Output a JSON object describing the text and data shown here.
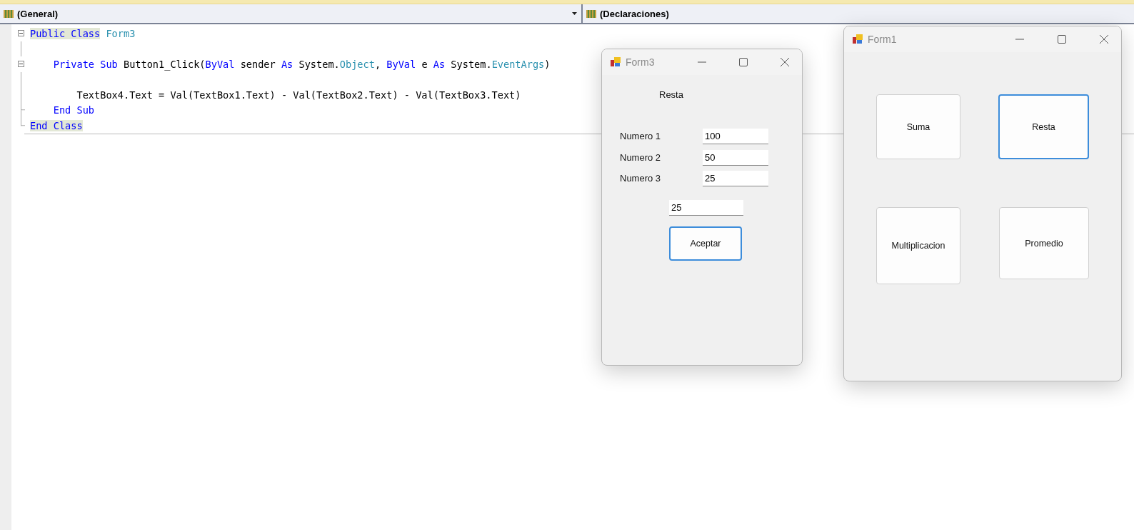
{
  "editor": {
    "object_dropdown": "(General)",
    "member_dropdown": "(Declaraciones)",
    "lines": [
      {
        "kind": "start",
        "tokens": [
          {
            "text": "Public Class",
            "kind": "keyword",
            "marked": true
          },
          {
            "text": " Form3",
            "kind": "type"
          }
        ]
      },
      {
        "kind": "body"
      },
      {
        "kind": "start",
        "tokens": [
          {
            "text": "    Private Sub",
            "kind": "keyword"
          },
          {
            "text": " Button1_Click(",
            "kind": "plain"
          },
          {
            "text": "ByVal",
            "kind": "keyword"
          },
          {
            "text": " sender ",
            "kind": "plain"
          },
          {
            "text": "As",
            "kind": "keyword"
          },
          {
            "text": " System.",
            "kind": "plain"
          },
          {
            "text": "Object",
            "kind": "type"
          },
          {
            "text": ", ",
            "kind": "plain"
          },
          {
            "text": "ByVal",
            "kind": "keyword"
          },
          {
            "text": " e ",
            "kind": "plain"
          },
          {
            "text": "As",
            "kind": "keyword"
          },
          {
            "text": " System.",
            "kind": "plain"
          },
          {
            "text": "EventArgs",
            "kind": "type"
          },
          {
            "text": ")",
            "kind": "plain"
          }
        ]
      },
      {
        "kind": "body"
      },
      {
        "kind": "body",
        "tokens": [
          {
            "text": "        TextBox4.Text = Val(TextBox1.Text) - Val(TextBox2.Text) - Val(TextBox3.Text)",
            "kind": "plain"
          }
        ]
      },
      {
        "kind": "end",
        "tokens": [
          {
            "text": "    End Sub",
            "kind": "keyword"
          }
        ]
      },
      {
        "kind": "end",
        "tokens": [
          {
            "text": "End Class",
            "kind": "keyword",
            "marked": true
          }
        ]
      }
    ]
  },
  "form3": {
    "title": "Form3",
    "heading": "Resta",
    "fields": [
      {
        "label": "Numero 1",
        "value": "100"
      },
      {
        "label": "Numero 2",
        "value": "50"
      },
      {
        "label": "Numero 3",
        "value": "25"
      }
    ],
    "result": "25",
    "button": {
      "label": "Aceptar",
      "focused": true
    }
  },
  "form1": {
    "title": "Form1",
    "buttons": [
      {
        "label": "Suma",
        "focused": false
      },
      {
        "label": "Resta",
        "focused": true
      },
      {
        "label": "Multiplicacion",
        "focused": false
      },
      {
        "label": "Promedio",
        "focused": false
      }
    ]
  }
}
